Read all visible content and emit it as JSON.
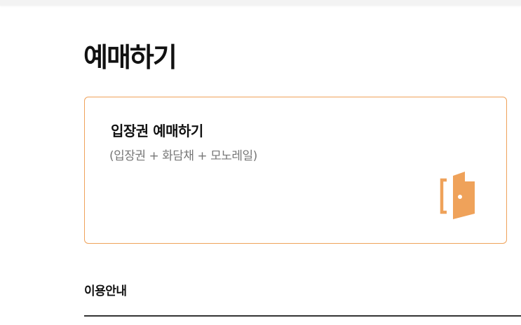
{
  "page": {
    "title": "예매하기"
  },
  "ticket_card": {
    "title": "입장권 예매하기",
    "subtitle": "(입장권 + 화담채 + 모노레일)",
    "icon": "door-icon",
    "accent_color": "#efa25a"
  },
  "info": {
    "title": "이용안내"
  }
}
